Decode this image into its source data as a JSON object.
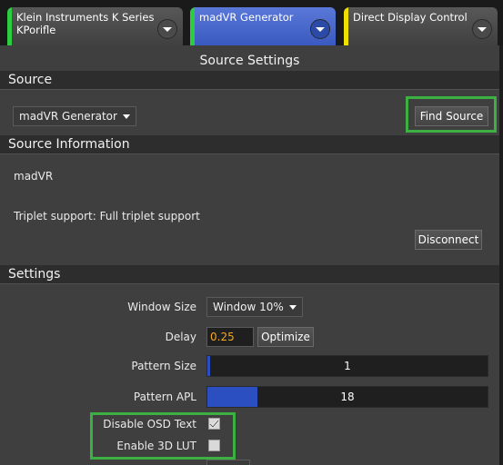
{
  "tabs": [
    {
      "label": "Klein Instruments K Series KPorifle",
      "stripe_color": "#2ecc40",
      "active": false
    },
    {
      "label": "madVR Generator",
      "stripe_color": "#2ecc40",
      "active": true
    },
    {
      "label": "Direct Display Control",
      "stripe_color": "#f0e000",
      "active": false
    }
  ],
  "title": "Source Settings",
  "source": {
    "header": "Source",
    "selected": "madVR Generator",
    "find_button": "Find Source"
  },
  "source_info": {
    "header": "Source Information",
    "name": "madVR",
    "triplet": "Triplet support: Full triplet support",
    "disconnect_button": "Disconnect"
  },
  "settings": {
    "header": "Settings",
    "window_size_label": "Window Size",
    "window_size_value": "Window 10%",
    "delay_label": "Delay",
    "delay_value": "0.25",
    "optimize_button": "Optimize",
    "pattern_size_label": "Pattern Size",
    "pattern_size_value": "1",
    "pattern_size_fill": 0.01,
    "pattern_apl_label": "Pattern APL",
    "pattern_apl_value": "18",
    "pattern_apl_fill": 0.18,
    "disable_osd_label": "Disable OSD Text",
    "disable_osd_checked": true,
    "enable_3dlut_label": "Enable 3D LUT",
    "enable_3dlut_checked": false
  },
  "colors": {
    "accent_blue": "#2b4fc1",
    "highlight_green": "#3cb043",
    "delay_text": "#f5a623"
  }
}
